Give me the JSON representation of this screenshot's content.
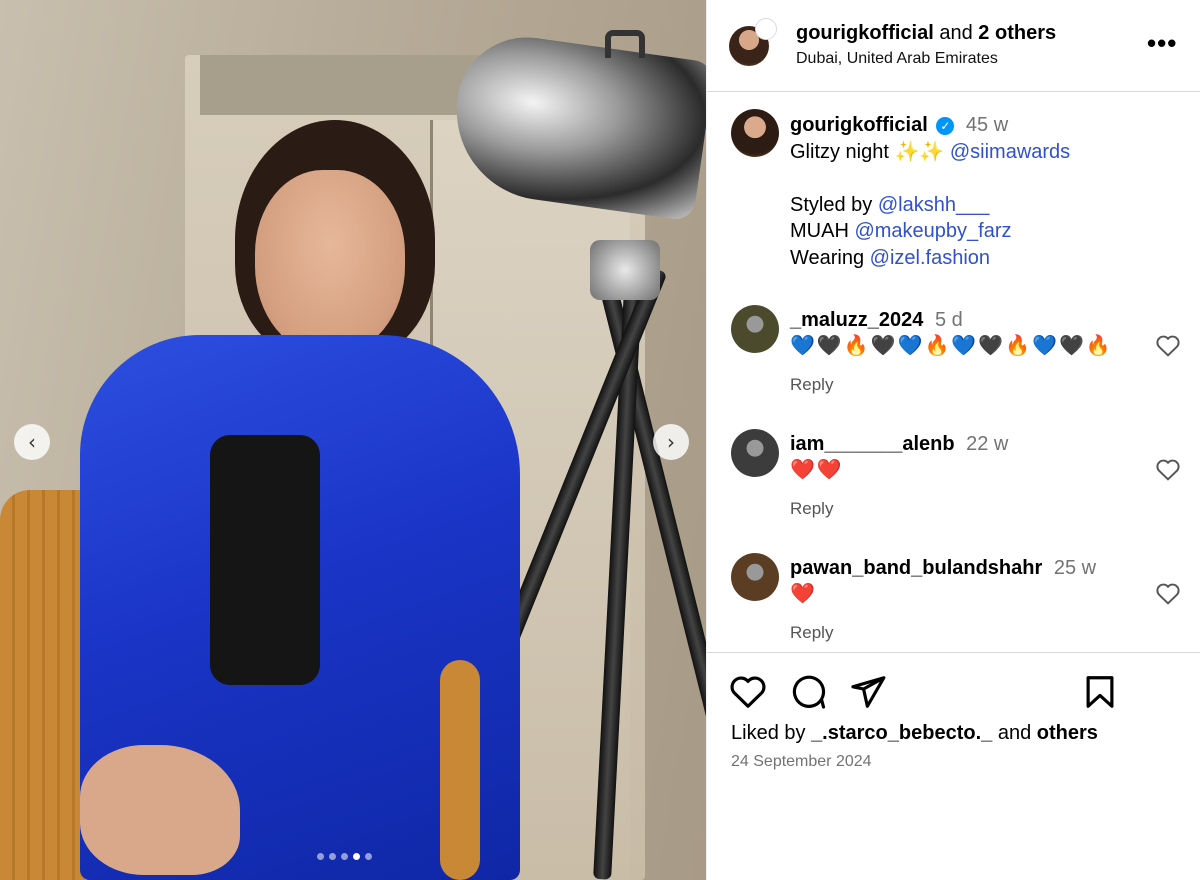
{
  "carousel": {
    "prev_icon": "‹",
    "next_icon": "›",
    "dots": [
      false,
      false,
      false,
      true,
      false
    ]
  },
  "header": {
    "username": "gourigkofficial",
    "collab_text": "and",
    "collab_others": "2 others",
    "location": "Dubai, United Arab Emirates",
    "more_icon": "•••"
  },
  "caption": {
    "username": "gourigkofficial",
    "verified_icon": "✓",
    "time": "45 w",
    "line1_text": "Glitzy night ",
    "line1_emoji": "✨✨",
    "line1_mention": "@siimawards",
    "line2_text": "Styled by ",
    "line2_mention": "@lakshh___",
    "line3_text": "MUAH ",
    "line3_mention": "@makeupby_farz",
    "line4_text": "Wearing ",
    "line4_mention": "@izel.fashion"
  },
  "comments": [
    {
      "username": "_maluzz_2024",
      "time": "5 d",
      "text": "💙🖤🔥🖤💙🔥💙🖤🔥💙🖤🔥",
      "reply": "Reply",
      "avatar_color": "#4b4a2c"
    },
    {
      "username": "iam_______alenb",
      "time": "22 w",
      "text": "❤️❤️",
      "reply": "Reply",
      "avatar_color": "#3c3c3c"
    },
    {
      "username": "pawan_band_bulandshahr",
      "time": "25 w",
      "text": "❤️",
      "reply": "Reply",
      "avatar_color": "#5a3d22"
    }
  ],
  "footer": {
    "liked_by_prefix": "Liked by",
    "liked_by_user": "_.starco_bebecto._",
    "liked_by_and": "and",
    "liked_by_others": "others",
    "date": "24 September 2024"
  },
  "colors": {
    "mention": "#3151cc",
    "verified": "#0095f6",
    "muted": "#737373"
  }
}
